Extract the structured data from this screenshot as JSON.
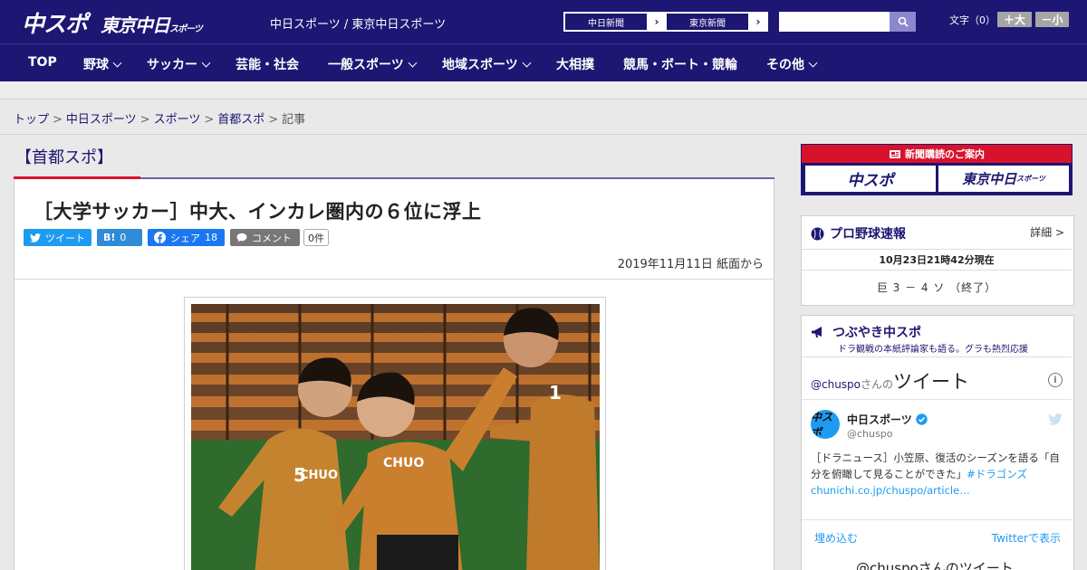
{
  "header": {
    "logo_chuspo": "中スポ",
    "logo_tokyo": "東京中日",
    "logo_tokyo_small": "スポーツ",
    "site_title": "中日スポーツ / 東京中日スポーツ",
    "paper_links": [
      "中日新聞",
      "東京新聞"
    ],
    "search": {
      "placeholder": "",
      "value": ""
    },
    "font_size_label": "文字（0）",
    "font_larger": "＋大",
    "font_smaller": "－小"
  },
  "nav": {
    "items": [
      {
        "label": "TOP",
        "has_menu": false
      },
      {
        "label": "野球",
        "has_menu": true
      },
      {
        "label": "サッカー",
        "has_menu": true
      },
      {
        "label": "芸能・社会",
        "has_menu": false
      },
      {
        "label": "一般スポーツ",
        "has_menu": true
      },
      {
        "label": "地域スポーツ",
        "has_menu": true
      },
      {
        "label": "大相撲",
        "has_menu": false
      },
      {
        "label": "競馬・ボート・競輪",
        "has_menu": false
      },
      {
        "label": "その他",
        "has_menu": true
      }
    ]
  },
  "breadcrumb": {
    "items": [
      "トップ",
      "中日スポーツ",
      "スポーツ",
      "首都スポ"
    ],
    "current": "記事",
    "separator": ">"
  },
  "article": {
    "section": "【首都スポ】",
    "headline": "［大学サッカー］中大、インカレ圏内の６位に浮上",
    "share": {
      "tweet": "ツイート",
      "hatena_icon": "B!",
      "hatena_count": "0",
      "facebook": "シェア",
      "facebook_count": "18",
      "comment": "コメント",
      "comment_count": "0件"
    },
    "date": "2019年11月11日 紙面から"
  },
  "sidebar": {
    "subscribe": {
      "title": "新聞購読のご案内",
      "logo_left": "中スポ",
      "logo_right": "東京中日",
      "logo_right_small": "スポーツ"
    },
    "baseball": {
      "title": "プロ野球速報",
      "detail": "詳細 >",
      "time": "10月23日21時42分現在",
      "score": "巨 3 － 4 ソ （終了）"
    },
    "tweets": {
      "title": "つぶやき中スポ",
      "subtitle": "ドラ観戦の本紙評論家も語る。グラも熱烈応援",
      "widget_handle_prefix": "@chuspo",
      "widget_handle_suffix": "さんの",
      "widget_title": "ツイート",
      "info": "i",
      "account_name": "中日スポーツ",
      "account_handle": "@chuspo",
      "avatar_text": "中スポ",
      "tweet_text_main": "［ドラニュース］小笠原、復活のシーズンを語る「自分を俯瞰して見ることができた」",
      "tweet_hashtag": "#ドラゴンズ",
      "tweet_link": "chunichi.co.jp/chuspo/article…",
      "embed": "埋め込む",
      "view_on_twitter": "Twitterで表示",
      "bottom_title": "@chuspoさんのツイート"
    }
  },
  "colors": {
    "brand_navy": "#1d1672",
    "accent_red": "#d9122c",
    "twitter_blue": "#1d9bf0",
    "facebook_blue": "#1a77f2"
  }
}
